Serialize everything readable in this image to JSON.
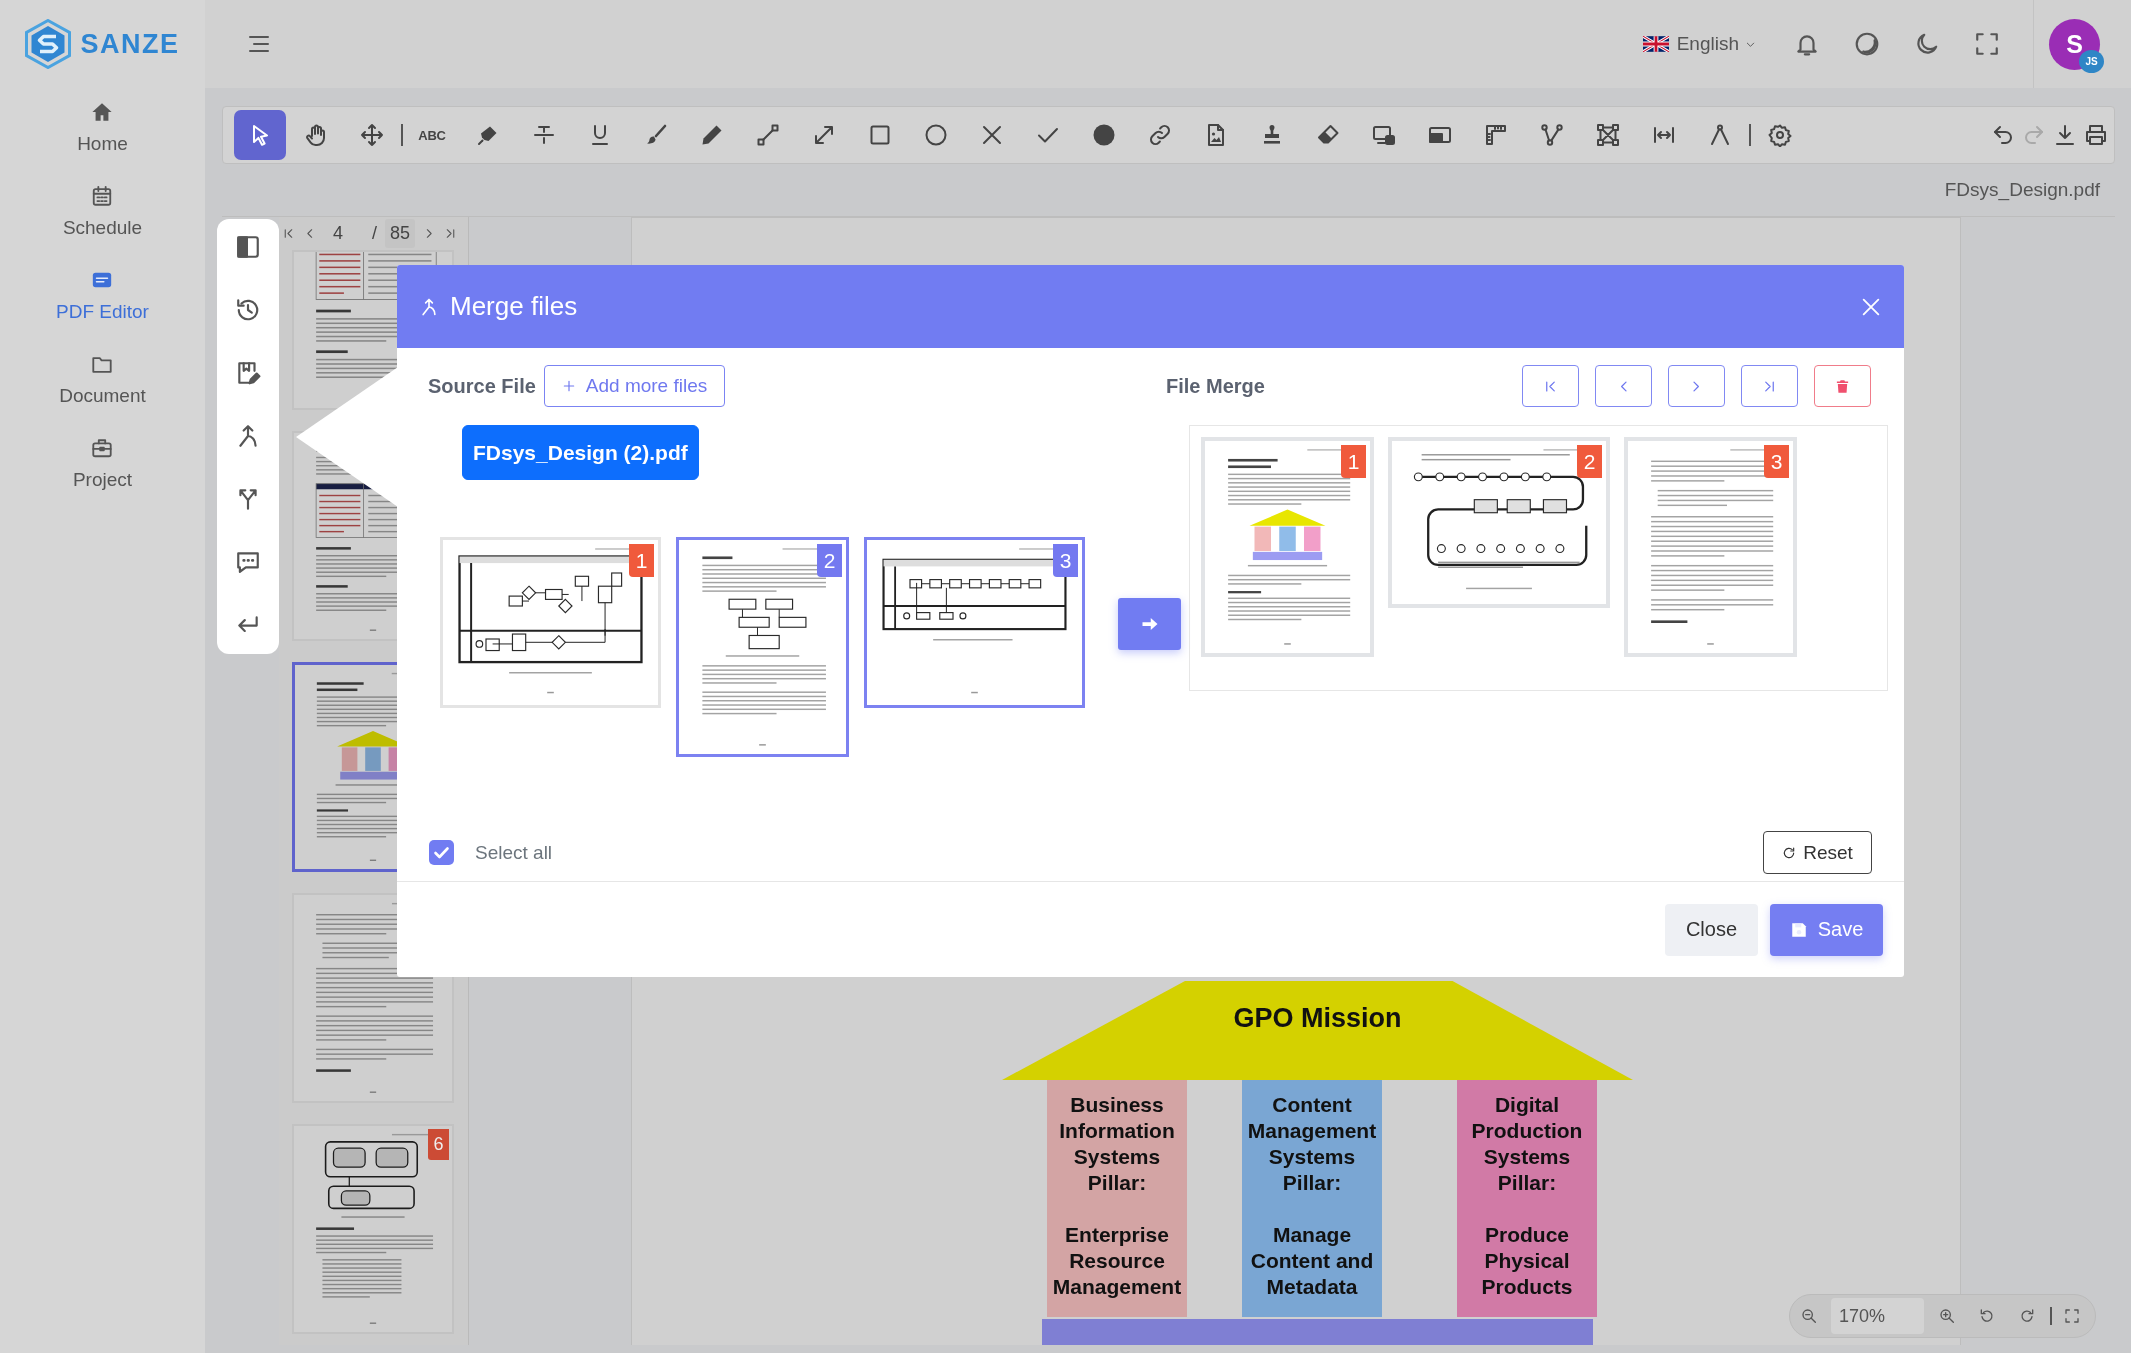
{
  "sidebar": {
    "logo": "SANZE",
    "items": [
      {
        "label": "Home",
        "selected": false
      },
      {
        "label": "Schedule",
        "selected": false
      },
      {
        "label": "PDF Editor",
        "selected": true
      },
      {
        "label": "Document",
        "selected": false
      },
      {
        "label": "Project",
        "selected": false
      }
    ]
  },
  "header": {
    "language": "English",
    "avatar": {
      "initial": "S",
      "badge": "JS"
    }
  },
  "toolbar": {
    "tools": [
      {
        "selected": true
      },
      {
        "selected": false
      },
      {
        "selected": false
      },
      {
        "label": "ABC",
        "selected": false
      },
      {
        "selected": false
      },
      {
        "selected": false
      },
      {
        "selected": false
      },
      {
        "selected": false
      },
      {
        "selected": false
      },
      {
        "selected": false
      },
      {
        "selected": false
      },
      {
        "selected": false
      },
      {
        "selected": false
      },
      {
        "selected": false
      },
      {
        "selected": false
      },
      {
        "selected": false
      },
      {
        "selected": false
      },
      {
        "selected": false
      },
      {
        "selected": false
      },
      {
        "selected": false
      },
      {
        "selected": false
      },
      {
        "selected": false
      },
      {
        "selected": false
      },
      {
        "selected": false
      },
      {
        "selected": false
      },
      {
        "selected": false
      },
      {
        "selected": false
      },
      {
        "selected": false
      }
    ],
    "actions": [
      {
        "disabled": false
      },
      {
        "disabled": true
      },
      {
        "disabled": false
      },
      {
        "disabled": false
      }
    ]
  },
  "document": {
    "file_name": "FDsys_Design.pdf",
    "page": "4",
    "page_separator": "/",
    "page_count": "85",
    "thumbnails": [
      {
        "kind": "table",
        "selected": false
      },
      {
        "kind": "table",
        "selected": false
      },
      {
        "kind": "pillars",
        "selected": true
      },
      {
        "kind": "text",
        "selected": false
      },
      {
        "kind": "database",
        "selected": false,
        "badge": "6"
      }
    ],
    "figure": {
      "title": "GPO Mission",
      "pillars": [
        {
          "heading": "Business Information Systems Pillar:",
          "body": "Enterprise Resource Management",
          "color": "#d3a4a4"
        },
        {
          "heading": "Content Management Systems Pillar:",
          "body": "Manage Content and Metadata",
          "color": "#7aa6d3"
        },
        {
          "heading": "Digital Production Systems Pillar:",
          "body": "Produce Physical Products",
          "color": "#d17aa6"
        }
      ]
    },
    "zoom": "170%"
  },
  "modal": {
    "title": "Merge files",
    "source_label": "Source File",
    "add_button": "Add more files",
    "files": [
      {
        "name": "FDsys_Design (2).pdf",
        "selected": true
      }
    ],
    "source_pages": [
      {
        "number": "1",
        "kind": "flowchart",
        "selected": false
      },
      {
        "number": "2",
        "kind": "boxes",
        "selected": true
      },
      {
        "number": "3",
        "kind": "swimlane",
        "selected": true
      }
    ],
    "merge_label": "File Merge",
    "merge_pages": [
      {
        "number": "1",
        "kind": "pillars"
      },
      {
        "number": "2",
        "kind": "pipeline"
      },
      {
        "number": "3",
        "kind": "text"
      }
    ],
    "select_all": {
      "label": "Select all",
      "checked": true
    },
    "reset_button": "Reset",
    "close_button": "Close",
    "save_button": "Save"
  }
}
